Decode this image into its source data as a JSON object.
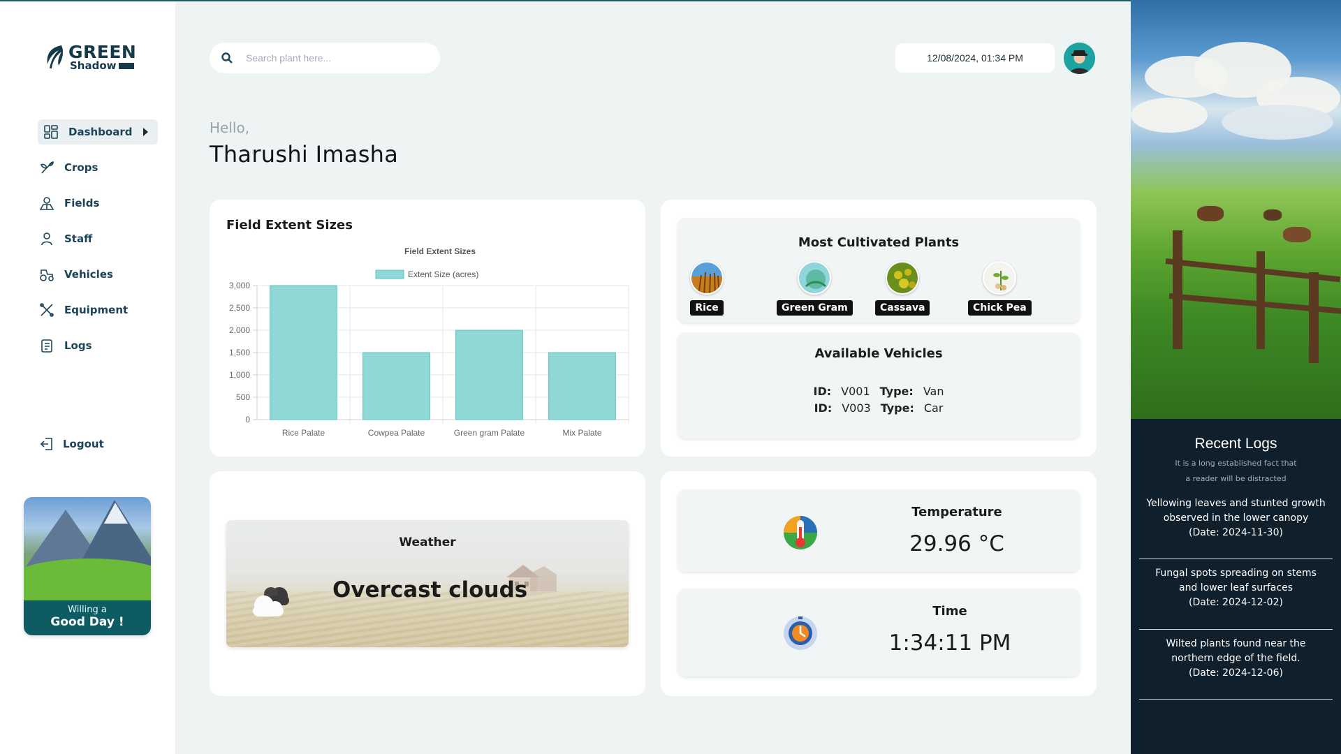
{
  "brand": {
    "name_top": "GREEN",
    "name_bottom": "Shadow"
  },
  "sidebar": {
    "items": [
      {
        "label": "Dashboard",
        "icon": "dashboard-icon",
        "active": true
      },
      {
        "label": "Crops",
        "icon": "sprout-icon"
      },
      {
        "label": "Fields",
        "icon": "field-icon"
      },
      {
        "label": "Staff",
        "icon": "person-icon"
      },
      {
        "label": "Vehicles",
        "icon": "tractor-icon"
      },
      {
        "label": "Equipment",
        "icon": "tools-icon"
      },
      {
        "label": "Logs",
        "icon": "logs-icon"
      }
    ],
    "logout_label": "Logout",
    "promo": {
      "line1": "Willing a",
      "line2": "Good Day !"
    }
  },
  "header": {
    "search_placeholder": "Search plant here...",
    "datetime": "12/08/2024, 01:34 PM"
  },
  "greeting": {
    "hello": "Hello,",
    "name": "Tharushi Imasha"
  },
  "field_chart_card": {
    "title": "Field Extent Sizes"
  },
  "chart_data": {
    "type": "bar",
    "title": "Field Extent Sizes",
    "categories": [
      "Rice Palate",
      "Cowpea Palate",
      "Green gram Palate",
      "Mix Palate"
    ],
    "series": [
      {
        "name": "Extent Size (acres)",
        "values": [
          3000,
          1500,
          2000,
          1500
        ]
      }
    ],
    "ylim": [
      0,
      3000
    ],
    "yticks": [
      0,
      500,
      1000,
      1500,
      2000,
      2500,
      3000
    ],
    "ytick_labels": [
      "0",
      "500",
      "1,000",
      "1,500",
      "2,000",
      "2,500",
      "3,000"
    ],
    "xlabel": "",
    "ylabel": "",
    "grid": true,
    "legend": "top",
    "bar_color": "#8fd8d6",
    "bar_border": "#5cc4c2"
  },
  "most_cultivated": {
    "title": "Most Cultivated Plants",
    "plants": [
      "Rice",
      "Green Gram",
      "Cassava",
      "Chick Pea"
    ]
  },
  "vehicles": {
    "title": "Available Vehicles",
    "id_label": "ID:",
    "type_label": "Type:",
    "rows": [
      {
        "id": "V001",
        "type": "Van"
      },
      {
        "id": "V003",
        "type": "Car"
      }
    ]
  },
  "weather": {
    "title": "Weather",
    "description": "Overcast clouds"
  },
  "temperature": {
    "title": "Temperature",
    "value": "29.96 °C"
  },
  "time": {
    "title": "Time",
    "value": "1:34:11 PM"
  },
  "recent_logs": {
    "title": "Recent Logs",
    "subtitle_line1": "It is a long established fact that",
    "subtitle_line2": "a reader will be distracted",
    "entries": [
      {
        "line1": "Yellowing leaves and stunted growth",
        "line2": "observed in the lower canopy",
        "date": "(Date: 2024-11-30)"
      },
      {
        "line1": "Fungal spots spreading on stems",
        "line2": "and lower leaf surfaces",
        "date": "(Date: 2024-12-02)"
      },
      {
        "line1": "Wilted plants found near the",
        "line2": "northern edge of the field.",
        "date": "(Date: 2024-12-06)"
      }
    ]
  },
  "colors": {
    "accent": "#0e5c63",
    "nav_text": "#1b4458",
    "background": "#eef4f4",
    "right_panel": "#0f1f2b"
  }
}
